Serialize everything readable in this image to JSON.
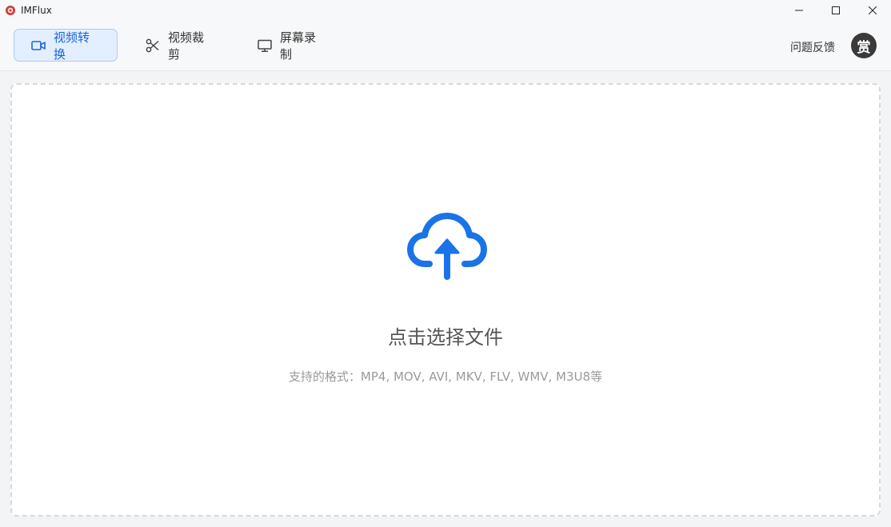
{
  "window": {
    "title": "IMFlux",
    "logo_icon": "app-logo-icon",
    "controls": [
      "minimize-icon",
      "maximize-icon",
      "close-icon"
    ]
  },
  "nav": {
    "tabs": [
      {
        "label": "视频转换",
        "icon": "video-camera-icon",
        "active": true
      },
      {
        "label": "视频裁剪",
        "icon": "scissors-icon",
        "active": false
      },
      {
        "label": "屏幕录制",
        "icon": "monitor-icon",
        "active": false
      }
    ],
    "feedback_label": "问题反馈",
    "avatar_label": "赏"
  },
  "dropzone": {
    "icon": "cloud-upload-icon",
    "title": "点击选择文件",
    "hint": "支持的格式：MP4, MOV, AVI, MKV, FLV, WMV, M3U8等"
  },
  "colors": {
    "accent": "#1a73e8",
    "active_tab_bg": "#e3efff",
    "active_tab_border": "#a9cdf6",
    "logo_red": "#d93a3a"
  }
}
